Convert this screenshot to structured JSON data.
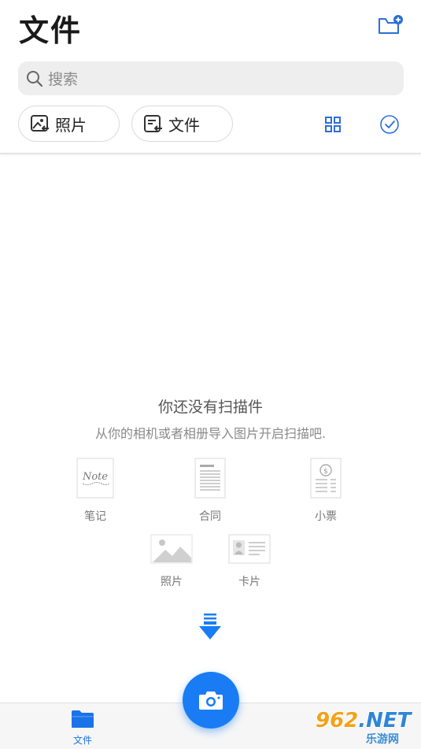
{
  "header": {
    "title": "文件",
    "new_folder_icon": "folder-add-icon"
  },
  "search": {
    "placeholder": "搜索"
  },
  "filters": {
    "photos_label": "照片",
    "files_label": "文件"
  },
  "empty_state": {
    "title": "你还没有扫描件",
    "subtitle": "从你的相机或者相册导入图片开启扫描吧."
  },
  "doc_types": [
    {
      "label": "笔记",
      "thumb_text": "Note"
    },
    {
      "label": "合同"
    },
    {
      "label": "小票"
    },
    {
      "label": "照片"
    },
    {
      "label": "卡片"
    }
  ],
  "bottom_nav": {
    "files_label": "文件"
  },
  "watermark": {
    "main": "962",
    "net": ".NET",
    "sub": "乐游网"
  },
  "colors": {
    "accent": "#1a7cf5",
    "icon_blue": "#2b6fd6"
  }
}
